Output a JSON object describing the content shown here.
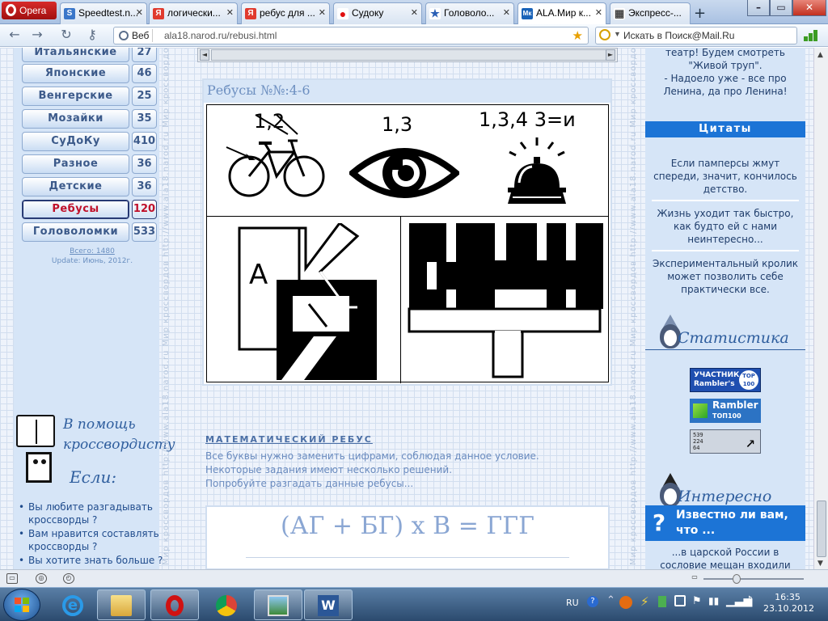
{
  "browser": {
    "opera_label": "Opera",
    "tabs": [
      {
        "label": "Speedtest.n...",
        "fav": "S",
        "fav_color": "#3a76c9"
      },
      {
        "label": "логически...",
        "fav": "Я",
        "fav_color": "#e03a2e"
      },
      {
        "label": "ребус для ...",
        "fav": "Я",
        "fav_color": "#e03a2e"
      },
      {
        "label": "Судоку",
        "fav": "●",
        "fav_color": "#e01010"
      },
      {
        "label": "Головоло...",
        "fav": "★",
        "fav_color": "#2a5fb5"
      },
      {
        "label": "ALA.Мир к...",
        "fav": "Мк",
        "fav_color": "#1a63b8"
      },
      {
        "label": "Экспресс-...",
        "fav": "▦",
        "fav_color": "#444"
      }
    ],
    "web_label": "Веб",
    "url": "ala18.narod.ru/rebusi.html",
    "search_placeholder": "Искать в Поиск@Mail.Ru"
  },
  "left": {
    "categories": [
      {
        "name": "Итальянские",
        "count": "27"
      },
      {
        "name": "Японские",
        "count": "46"
      },
      {
        "name": "Венгерские",
        "count": "25"
      },
      {
        "name": "Мозайки",
        "count": "35"
      },
      {
        "name": "СуДоКу",
        "count": "410"
      },
      {
        "name": "Разное",
        "count": "36"
      },
      {
        "name": "Детские",
        "count": "36"
      },
      {
        "name": "Ребусы",
        "count": "120"
      },
      {
        "name": "Головоломки",
        "count": "533"
      }
    ],
    "total": "Всего: 1480",
    "update": "Update: Июнь, 2012г.",
    "helper_title": "В помощь кроссвордисту",
    "if_title": "Если:",
    "if_items": [
      "Вы любите разгадывать кроссворды ?",
      "Вам нравится составлять кроссворды ?",
      "Вы хотите знать больше ?"
    ]
  },
  "strip_text": "Мир кроссвордов  http://www.ala18.narod.ru  Мир кроссвордов  http://www.ala18.narod.ru  Мир кроссвордов  http://www.ala18.narod.ru",
  "center": {
    "rebus_title": "Ребусы №№:4-6",
    "rebus_labels": {
      "bike": "1,2",
      "eye": "1,3",
      "bell": "1,3,4  3=и"
    },
    "rebus_letters": {
      "a": "А"
    },
    "math_heading": "МАТЕМАТИЧЕСКИЙ РЕБУС",
    "math_lines": [
      "Все буквы нужно заменить цифрами, соблюдая данное условие.",
      "Некоторые задания имеют несколько решений.",
      "Попробуйте разгадать данные ребусы..."
    ],
    "equation": "(АГ + БГ) х В = ГГГ"
  },
  "right": {
    "joke_lines": [
      "театр! Будем смотреть",
      "\"Живой труп\".",
      "- Надоело уже - все про",
      "Ленина, да про Ленина!"
    ],
    "quotes_heading": "Цитаты",
    "quotes": [
      "Если памперсы жмут спереди, значит, кончилось детство.",
      "Жизнь уходит так быстро, как будто ей с нами неинтересно...",
      "Экспериментальный кролик может позволить себе практически все."
    ],
    "stats_heading": "Статистика",
    "rambler_badge": {
      "line1": "УЧАСТНИК",
      "line2": "Rambler's",
      "top": "TOP 100"
    },
    "rambler_top": {
      "line1": "Rambler",
      "line2": "ТОП100"
    },
    "counter_lines": [
      "539",
      "224",
      "64"
    ],
    "interesting_heading": "Интересно",
    "did_you_know": "Известно ли вам, что ...",
    "did_body": "...в царской России в сословие мещан входили"
  },
  "taskbar": {
    "lang": "RU",
    "time": "16:35",
    "date": "23.10.2012"
  }
}
